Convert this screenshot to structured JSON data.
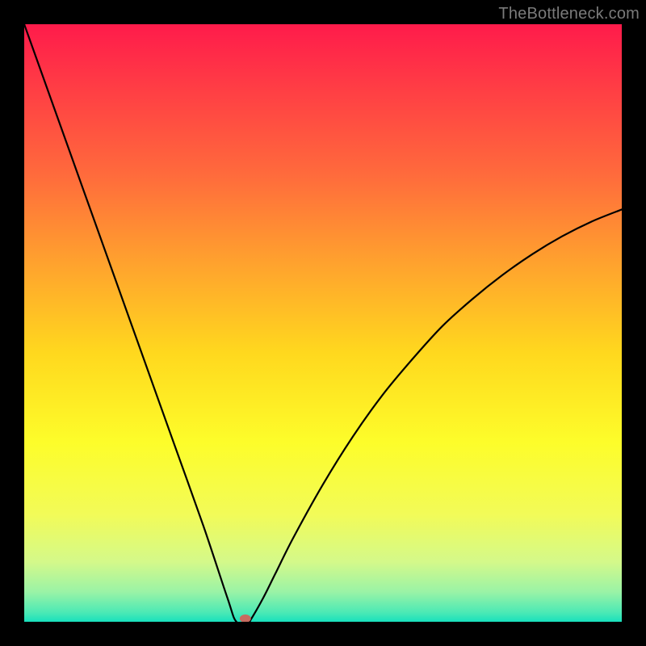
{
  "watermark": "TheBottleneck.com",
  "chart_data": {
    "type": "line",
    "title": "",
    "xlabel": "",
    "ylabel": "",
    "xlim": [
      0,
      100
    ],
    "ylim": [
      0,
      100
    ],
    "x": [
      0,
      5,
      10,
      15,
      20,
      25,
      30,
      34,
      35.5,
      37.5,
      38,
      40,
      42,
      45,
      50,
      55,
      60,
      65,
      70,
      75,
      80,
      85,
      90,
      95,
      100
    ],
    "values": [
      100,
      86,
      72,
      58,
      44,
      30,
      16,
      4,
      0,
      0,
      0.5,
      4,
      8,
      14,
      23,
      31,
      38,
      44,
      49.5,
      54,
      58,
      61.5,
      64.5,
      67,
      69
    ],
    "marker": {
      "x": 37,
      "y": 0,
      "color": "#c66b5f"
    },
    "gradient_stops": [
      {
        "offset": 0.0,
        "color": "#ff1b4b"
      },
      {
        "offset": 0.1,
        "color": "#ff3b45"
      },
      {
        "offset": 0.25,
        "color": "#ff6a3c"
      },
      {
        "offset": 0.4,
        "color": "#ffa22e"
      },
      {
        "offset": 0.55,
        "color": "#ffd81e"
      },
      {
        "offset": 0.7,
        "color": "#fdfd2a"
      },
      {
        "offset": 0.82,
        "color": "#f2fb58"
      },
      {
        "offset": 0.9,
        "color": "#d4f98a"
      },
      {
        "offset": 0.95,
        "color": "#9af3a6"
      },
      {
        "offset": 0.985,
        "color": "#4ae9b5"
      },
      {
        "offset": 1.0,
        "color": "#18e0bd"
      }
    ]
  }
}
